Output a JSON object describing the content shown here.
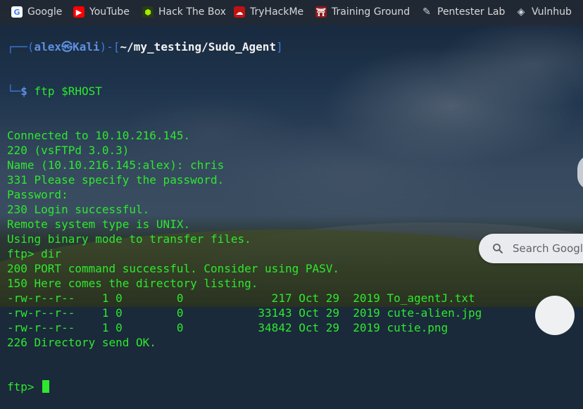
{
  "bookmarks": [
    {
      "label": "Google",
      "icon": "google-icon",
      "color": "#4285f4"
    },
    {
      "label": "YouTube",
      "icon": "youtube-icon",
      "color": "#ff0000"
    },
    {
      "label": "Hack The Box",
      "icon": "hackthebox-icon",
      "color": "#9fef00"
    },
    {
      "label": "TryHackMe",
      "icon": "tryhackme-icon",
      "color": "#c11111"
    },
    {
      "label": "Training Ground",
      "icon": "training-ground-icon",
      "color": "#c0392b"
    },
    {
      "label": "Pentester Lab",
      "icon": "pentesterlab-icon",
      "color": "#cfd3d8"
    },
    {
      "label": "Vulnhub",
      "icon": "vulnhub-icon",
      "color": "#cfd3d8"
    }
  ],
  "terminal": {
    "prompt_user": "alex",
    "prompt_host": "Kali",
    "prompt_path": "~/my_testing/Sudo_Agent",
    "prompt_symbol": "$",
    "command": "ftp $RHOST",
    "output_lines": [
      "Connected to 10.10.216.145.",
      "220 (vsFTPd 3.0.3)",
      "Name (10.10.216.145:alex): chris",
      "331 Please specify the password.",
      "Password:",
      "230 Login successful.",
      "Remote system type is UNIX.",
      "Using binary mode to transfer files.",
      "ftp> dir",
      "200 PORT command successful. Consider using PASV.",
      "150 Here comes the directory listing.",
      "-rw-r--r--    1 0        0             217 Oct 29  2019 To_agentJ.txt",
      "-rw-r--r--    1 0        0           33143 Oct 29  2019 cute-alien.jpg",
      "-rw-r--r--    1 0        0           34842 Oct 29  2019 cutie.png",
      "226 Directory send OK."
    ],
    "current_prompt": "ftp> "
  },
  "search": {
    "placeholder": "Search Google"
  }
}
